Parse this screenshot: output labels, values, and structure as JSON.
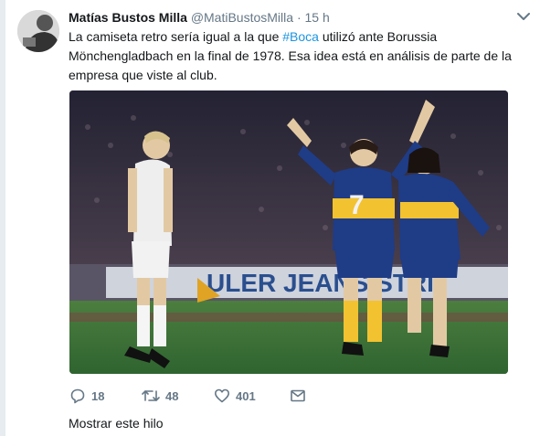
{
  "tweet": {
    "author_name": "Matías Bustos Milla",
    "handle": "@MatiBustosMilla",
    "separator": "·",
    "time": "15 h",
    "text_before": "La camiseta retro sería igual a la que ",
    "hashtag": "#Boca",
    "text_after": " utilizó ante Borussia Mönchengladbach en la final de 1978. Esa idea está en análisis de parte de la empresa que viste al club.",
    "media_text": {
      "jersey_number": "7",
      "banner_text": "ULER JEANS STRI"
    },
    "actions": {
      "reply_count": "18",
      "retweet_count": "48",
      "like_count": "401"
    },
    "show_thread_label": "Mostrar este hilo"
  },
  "colors": {
    "name": "#14171a",
    "secondary": "#657786",
    "hashtag": "#1b95e0",
    "boca_blue": "#1f3c86",
    "boca_gold": "#f2c230",
    "pitch": "#3f7a3a"
  },
  "icons": [
    "avatar",
    "chevron-down-icon",
    "reply-icon",
    "retweet-icon",
    "like-icon",
    "message-icon"
  ]
}
